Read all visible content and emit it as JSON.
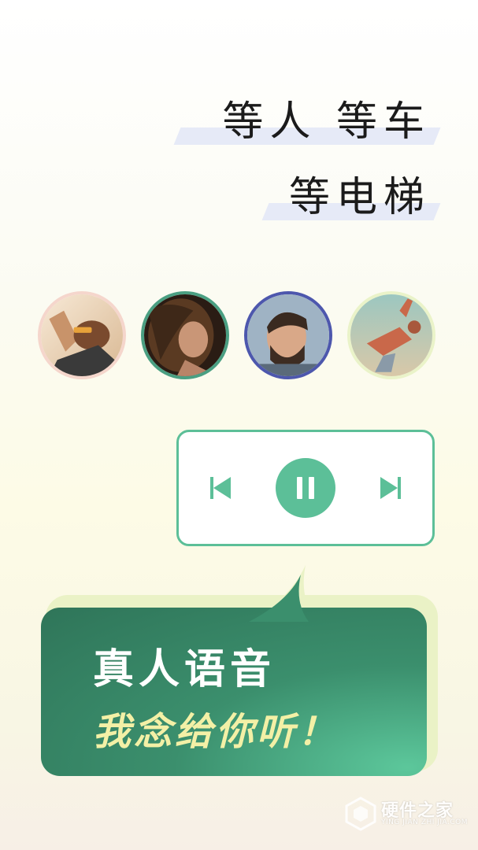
{
  "headline": {
    "line1": "等人 等车",
    "line2": "等电梯"
  },
  "avatars": [
    {
      "icon": "avatar-man-sunglasses-photo",
      "border_color": "#f5d6cc"
    },
    {
      "icon": "avatar-woman-curly-hair-photo",
      "border_color": "#4a9f82"
    },
    {
      "icon": "avatar-man-beard-photo",
      "border_color": "#4d57ad"
    },
    {
      "icon": "avatar-man-jumping-photo",
      "border_color": "#eaf3c9"
    }
  ],
  "player": {
    "prev_icon": "skip-previous-icon",
    "pause_icon": "pause-icon",
    "next_icon": "skip-next-icon",
    "accent": "#5cbf98"
  },
  "bubble": {
    "title": "真人语音",
    "subtitle": "我念给你听！",
    "color": "#3b8f6d",
    "subtitle_color": "#f3f0a6"
  },
  "watermark": {
    "title": "硬件之家",
    "subtitle": "YING JIAN ZHI JIA.COM"
  }
}
